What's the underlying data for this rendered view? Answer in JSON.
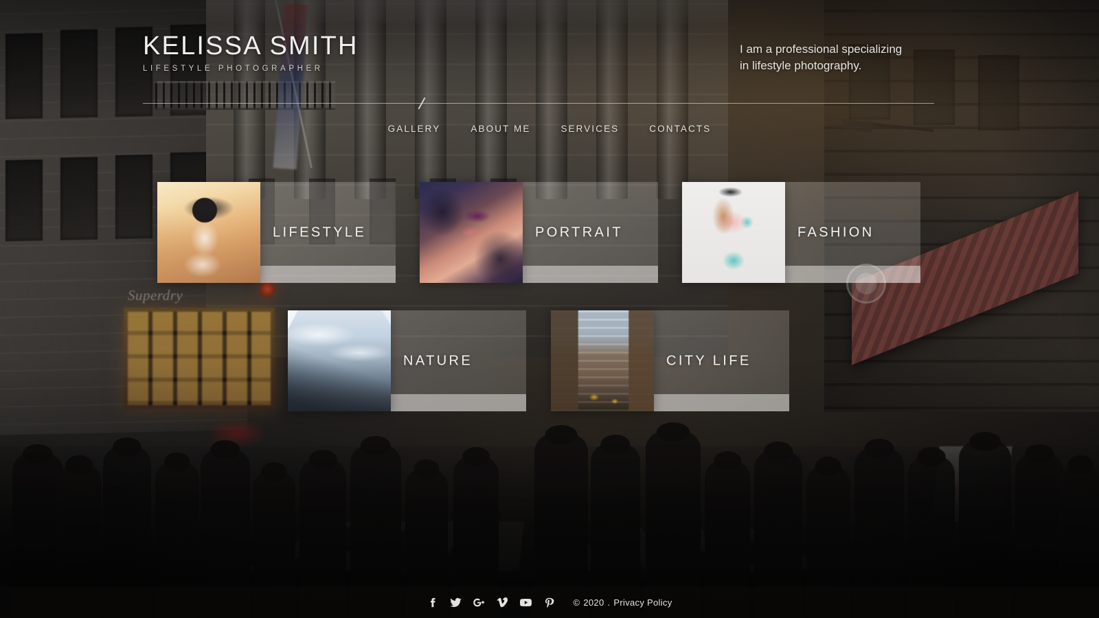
{
  "site": {
    "logo_name": "KELISSA SMITH",
    "logo_subtitle": "LIFESTYLE PHOTOGRAPHER",
    "tagline_line1": "I am a professional specializing",
    "tagline_line2": "in lifestyle photography.",
    "accent_color": "#f2f1ee",
    "panel_color": "#ecebe8",
    "background": "dark-city-street-photo"
  },
  "nav": {
    "items": [
      {
        "label": "GALLERY"
      },
      {
        "label": "ABOUT ME"
      },
      {
        "label": "SERVICES"
      },
      {
        "label": "CONTACTS"
      }
    ]
  },
  "gallery": {
    "tiles": [
      {
        "label": "LIFESTYLE",
        "thumb": "woman-in-sunhat-on-beach"
      },
      {
        "label": "PORTRAIT",
        "thumb": "beauty-portrait-curly-hair"
      },
      {
        "label": "FASHION",
        "thumb": "model-pink-top-teal-shorts"
      },
      {
        "label": "NATURE",
        "thumb": "snow-capped-mountain-range"
      },
      {
        "label": "CITY LIFE",
        "thumb": "new-york-street-with-flags"
      }
    ]
  },
  "footer": {
    "social": [
      {
        "name": "facebook",
        "glyph": "f"
      },
      {
        "name": "twitter",
        "glyph": "t"
      },
      {
        "name": "google-plus",
        "glyph": "G+"
      },
      {
        "name": "vimeo",
        "glyph": "v"
      },
      {
        "name": "youtube",
        "glyph": "yt"
      },
      {
        "name": "pinterest",
        "glyph": "P"
      }
    ],
    "copyright_mark": "©",
    "year": "2020",
    "separator": ".",
    "privacy_label": "Privacy Policy"
  }
}
